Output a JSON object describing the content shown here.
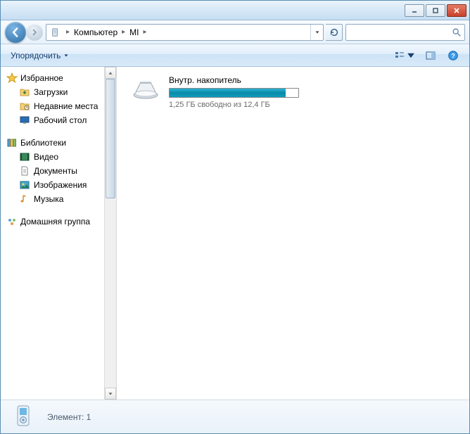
{
  "titlebar": {},
  "nav": {
    "breadcrumb": [
      "Компьютер",
      "MI"
    ]
  },
  "toolbar": {
    "organize": "Упорядочить"
  },
  "sidebar": {
    "favorites": {
      "header": "Избранное",
      "items": [
        "Загрузки",
        "Недавние места",
        "Рабочий стол"
      ]
    },
    "libraries": {
      "header": "Библиотеки",
      "items": [
        "Видео",
        "Документы",
        "Изображения",
        "Музыка"
      ]
    },
    "homegroup": {
      "header": "Домашняя группа"
    }
  },
  "main": {
    "drive": {
      "name": "Внутр. накопитель",
      "free_text": "1,25 ГБ свободно из 12,4 ГБ",
      "fill_percent": 90
    }
  },
  "status": {
    "text": "Элемент: 1"
  }
}
